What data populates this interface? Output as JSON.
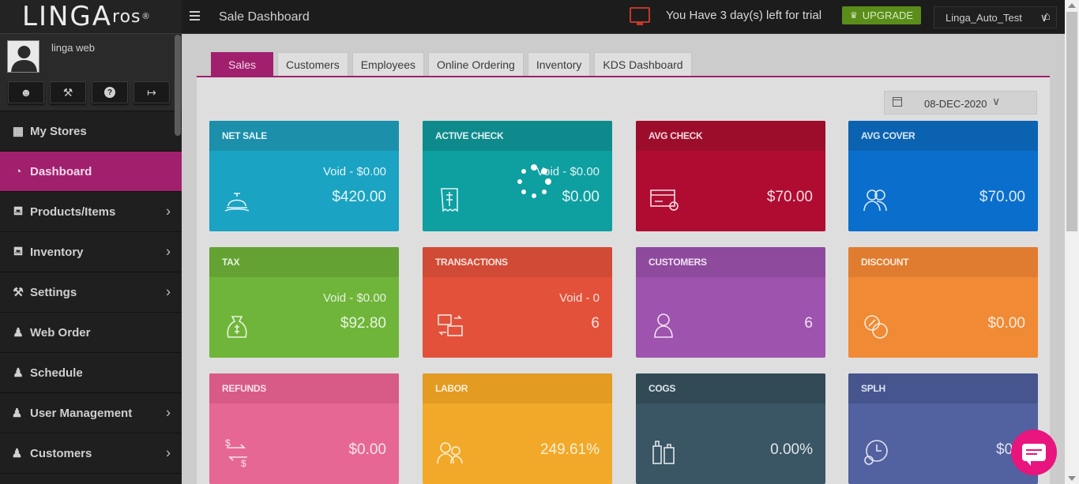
{
  "logo": {
    "main": "LINGA",
    "suffix": "ros",
    "reg": "®"
  },
  "user": {
    "name": "linga web"
  },
  "sidebar": {
    "items": [
      {
        "label": "My Stores",
        "icon": "store-icon",
        "chevron": false
      },
      {
        "label": "Dashboard",
        "icon": "dashboard-icon",
        "chevron": false,
        "active": true
      },
      {
        "label": "Products/Items",
        "icon": "basket-icon",
        "chevron": true
      },
      {
        "label": "Inventory",
        "icon": "basket-icon",
        "chevron": true
      },
      {
        "label": "Settings",
        "icon": "wrench-icon",
        "chevron": true
      },
      {
        "label": "Web Order",
        "icon": "person-icon",
        "chevron": false
      },
      {
        "label": "Schedule",
        "icon": "person-icon",
        "chevron": false
      },
      {
        "label": "User Management",
        "icon": "users-icon",
        "chevron": true
      },
      {
        "label": "Customers",
        "icon": "users-icon",
        "chevron": true
      }
    ]
  },
  "topbar": {
    "title": "Sale Dashboard",
    "trial": "You Have 3 day(s) left for trial",
    "upgrade": "UPGRADE",
    "store": "Linga_Auto_Test"
  },
  "tabs": [
    "Sales",
    "Customers",
    "Employees",
    "Online Ordering",
    "Inventory",
    "KDS Dashboard"
  ],
  "date": "08-DEC-2020",
  "cards": [
    {
      "title": "NET SALE",
      "sub": "Void - $0.00",
      "value": "$420.00",
      "icon": "serving-bell-icon",
      "head": "#1c8fab",
      "body": "#1aa3c2",
      "text": "#e6f4f8"
    },
    {
      "title": "ACTIVE CHECK",
      "sub": "Void - $0.00",
      "value": "$0.00",
      "icon": "receipt-icon",
      "head": "#0f8a8c",
      "body": "#0e9fa1",
      "text": "#e0f2f2"
    },
    {
      "title": "AVG CHECK",
      "sub": "",
      "value": "$70.00",
      "icon": "credit-card-icon",
      "head": "#9c0d2c",
      "body": "#b00c31",
      "text": "#f6dce2"
    },
    {
      "title": "AVG COVER",
      "sub": "",
      "value": "$70.00",
      "icon": "users-icon",
      "head": "#0b62b0",
      "body": "#0a6fcc",
      "text": "#dbe9f7"
    },
    {
      "title": "TAX",
      "sub": "Void - $0.00",
      "value": "$92.80",
      "icon": "money-bag-icon",
      "head": "#63a233",
      "body": "#6fb53a",
      "text": "#e8f3df"
    },
    {
      "title": "TRANSACTIONS",
      "sub": "Void - 0",
      "value": "6",
      "icon": "transfer-icon",
      "head": "#d14a35",
      "body": "#e3513a",
      "text": "#fae3de"
    },
    {
      "title": "CUSTOMERS",
      "sub": "",
      "value": "6",
      "icon": "person-icon",
      "head": "#8e4a9d",
      "body": "#9e53ae",
      "text": "#f1e3f4"
    },
    {
      "title": "DISCOUNT",
      "sub": "",
      "value": "$0.00",
      "icon": "discount-icon",
      "head": "#e07c2f",
      "body": "#f08a35",
      "text": "#fcebdc"
    },
    {
      "title": "REFUNDS",
      "sub": "",
      "value": "$0.00",
      "icon": "refund-icon",
      "head": "#d85a86",
      "body": "#e66793",
      "text": "#fbe3ec"
    },
    {
      "title": "LABOR",
      "sub": "",
      "value": "249.61%",
      "icon": "workers-icon",
      "head": "#e39b22",
      "body": "#f2a929",
      "text": "#fcf0d8"
    },
    {
      "title": "COGS",
      "sub": "",
      "value": "0.00%",
      "icon": "bottles-icon",
      "head": "#324a56",
      "body": "#3a5563",
      "text": "#dfe7ec"
    },
    {
      "title": "SPLH",
      "sub": "",
      "value": "$0.0",
      "icon": "clock-users-icon",
      "head": "#46558e",
      "body": "#52619f",
      "text": "#e1e4f1"
    }
  ]
}
